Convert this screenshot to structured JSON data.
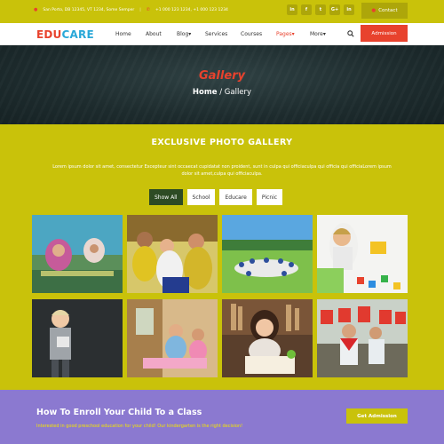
{
  "topbar": {
    "address": "San Porto, DB 12345, VT 1234, Some Semper",
    "divider": "|",
    "phones": "+1 000 123 1234, +1 000 123 1234",
    "social": [
      "in",
      "f",
      "t",
      "G+",
      "in"
    ],
    "contact_label": "Contact"
  },
  "nav": {
    "logo_part1": "EDU",
    "logo_part2": "CARE",
    "menu": [
      "Home",
      "About",
      "Blog",
      "Services",
      "Courses",
      "Pages",
      "More"
    ],
    "dropdown_marker": "▾",
    "admission_label": "Admission"
  },
  "hero": {
    "title": "Gallery",
    "crumb_home": "Home",
    "crumb_sep": " / ",
    "crumb_current": "Gallery"
  },
  "gallery": {
    "heading": "EXCLUSIVE PHOTO GALLERY",
    "description": "Lorem ipsum dolor sit amet, consectetur Excepteur sint occaecat cupidatat non proident, sunt in culpa qui officiaculpa qui officia qui officiaLorem ipsum dolor sit amet,culpa qui officiaculpa.",
    "filters": [
      "Show All",
      "School",
      "Educare",
      "Picnic"
    ],
    "active_filter": "Show All"
  },
  "enroll": {
    "title": "How To Enroll Your Child To a Class",
    "subtitle": "Interested in good preschool education for your child! Our kindergarten is the right decision!",
    "button_label": "Get Admission"
  },
  "colors": {
    "accent_red": "#e8422d",
    "brand_blue": "#2aa8d8",
    "olive_yellow": "#c9c20a",
    "purple": "#8b79d0"
  }
}
